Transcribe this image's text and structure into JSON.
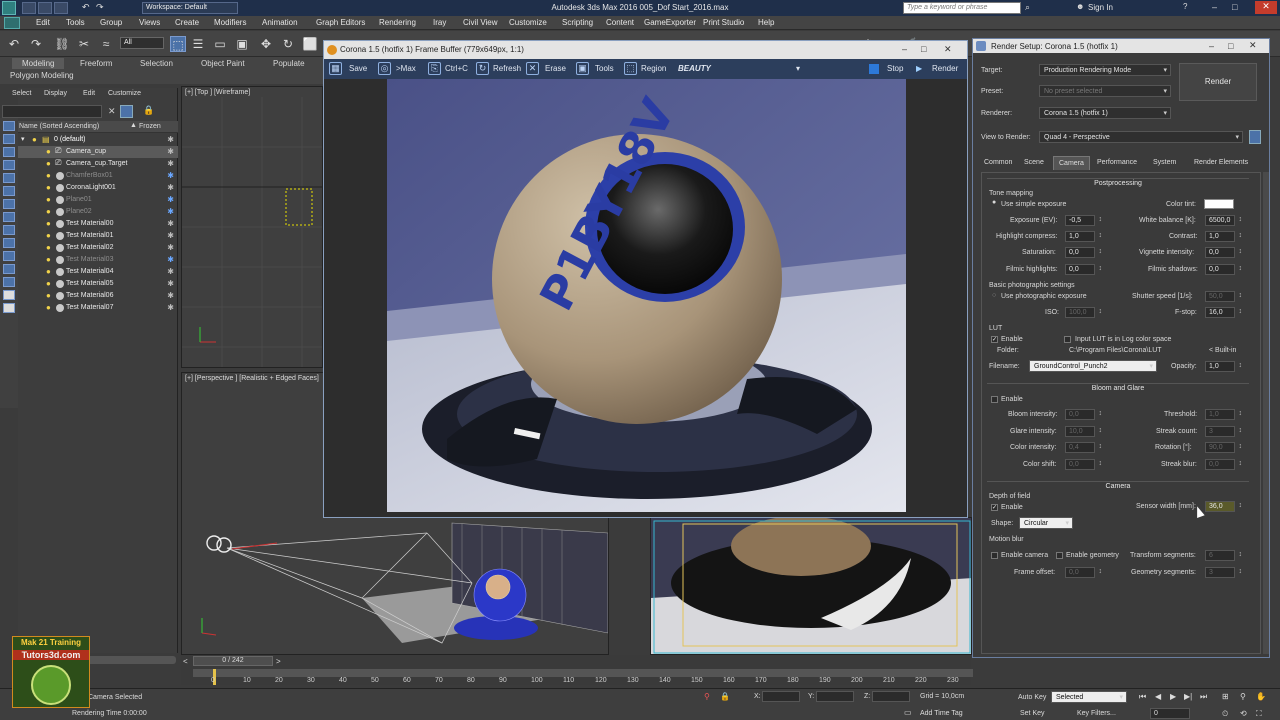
{
  "app": {
    "title": "Autodesk 3ds Max 2016    005_Dof Start_2016.max",
    "workspace": "Workspace: Default",
    "search_placeholder": "Type a keyword or phrase",
    "sign_in": "Sign In"
  },
  "menus": [
    "Edit",
    "Tools",
    "Group",
    "Views",
    "Create",
    "Modifiers",
    "Animation",
    "Graph Editors",
    "Rendering",
    "Iray",
    "Civil View",
    "Customize",
    "Scripting",
    "Content",
    "GameExporter",
    "Print Studio",
    "Help"
  ],
  "toolbar": {
    "selection_filter": "All"
  },
  "ribbon": {
    "tabs": [
      "Modeling",
      "Freeform",
      "Selection",
      "Object Paint",
      "Populate"
    ],
    "sub": "Polygon Modeling"
  },
  "explorer": {
    "menus": [
      "Select",
      "Display",
      "Edit",
      "Customize"
    ],
    "col_name": "Name (Sorted Ascending)",
    "col_frozen": "Frozen",
    "items": [
      {
        "name": "0 (default)",
        "type": "layer",
        "selected": false,
        "dim": false
      },
      {
        "name": "Camera_cup",
        "type": "camera",
        "selected": true,
        "dim": false
      },
      {
        "name": "Camera_cup.Target",
        "type": "camera",
        "selected": false,
        "dim": false
      },
      {
        "name": "ChamferBox01",
        "type": "object",
        "selected": false,
        "dim": true
      },
      {
        "name": "CoronaLight001",
        "type": "object",
        "selected": false,
        "dim": false
      },
      {
        "name": "Plane01",
        "type": "object",
        "selected": false,
        "dim": true
      },
      {
        "name": "Plane02",
        "type": "object",
        "selected": false,
        "dim": true
      },
      {
        "name": "Test Material00",
        "type": "object",
        "selected": false,
        "dim": false
      },
      {
        "name": "Test Material01",
        "type": "object",
        "selected": false,
        "dim": false
      },
      {
        "name": "Test Material02",
        "type": "object",
        "selected": false,
        "dim": false
      },
      {
        "name": "Test Material03",
        "type": "object",
        "selected": false,
        "dim": true
      },
      {
        "name": "Test Material04",
        "type": "object",
        "selected": false,
        "dim": false
      },
      {
        "name": "Test Material05",
        "type": "object",
        "selected": false,
        "dim": false
      },
      {
        "name": "Test Material06",
        "type": "object",
        "selected": false,
        "dim": false
      },
      {
        "name": "Test Material07",
        "type": "object",
        "selected": false,
        "dim": false
      }
    ]
  },
  "viewports": {
    "top": "[+] [Top ] [Wireframe]",
    "perspective": "[+] [Perspective ] [Realistic + Edged Faces]"
  },
  "framebuffer": {
    "title": "Corona 1.5 (hotfix 1) Frame Buffer (779x649px, 1:1)",
    "save": "Save",
    "max": ">Max",
    "ctrlc": "Ctrl+C",
    "refresh": "Refresh",
    "erase": "Erase",
    "tools": "Tools",
    "region": "Region",
    "channel": "BEAUTY",
    "stop": "Stop",
    "render": "Render",
    "sphere_text": "P1BY18V"
  },
  "render_setup": {
    "title": "Render Setup: Corona 1.5 (hotfix 1)",
    "target_label": "Target:",
    "target": "Production Rendering Mode",
    "preset_label": "Preset:",
    "preset": "No preset selected",
    "renderer_label": "Renderer:",
    "renderer": "Corona 1.5 (hotfix 1)",
    "view_label": "View to Render:",
    "view": "Quad 4 - Perspective",
    "render_btn": "Render",
    "tabs": [
      "Common",
      "Scene",
      "Camera",
      "Performance",
      "System",
      "Render Elements"
    ],
    "postprocessing": "Postprocessing",
    "tone_mapping": "Tone mapping",
    "use_simple_exposure": "Use simple exposure",
    "color_tint": "Color tint:",
    "exposure": {
      "label": "Exposure (EV):",
      "value": "-0,5"
    },
    "white_balance": {
      "label": "White balance [K]:",
      "value": "6500,0"
    },
    "highlight": {
      "label": "Highlight compress:",
      "value": "1,0"
    },
    "contrast": {
      "label": "Contrast:",
      "value": "1,0"
    },
    "saturation": {
      "label": "Saturation:",
      "value": "0,0"
    },
    "vignette": {
      "label": "Vignette intensity:",
      "value": "0,0"
    },
    "filmic_high": {
      "label": "Filmic highlights:",
      "value": "0,0"
    },
    "filmic_shad": {
      "label": "Filmic shadows:",
      "value": "0,0"
    },
    "basic_photo": "Basic photographic settings",
    "use_photo": "Use photographic exposure",
    "shutter": {
      "label": "Shutter speed [1/s]:",
      "value": "50,0"
    },
    "iso": {
      "label": "ISO:",
      "value": "100,0"
    },
    "fstop": {
      "label": "F-stop:",
      "value": "16,0"
    },
    "lut": "LUT",
    "lut_enable": "Enable",
    "lut_log": "Input LUT is in Log color space",
    "folder_label": "Folder:",
    "folder": "C:\\Program Files\\Corona\\LUT",
    "builtin": "< Built-in",
    "filename_label": "Filename:",
    "filename": "GroundControl_Punch2",
    "opacity": {
      "label": "Opacity:",
      "value": "1,0"
    },
    "bloom": "Bloom and Glare",
    "bloom_enable": "Enable",
    "bloom_int": {
      "label": "Bloom intensity:",
      "value": "0,0"
    },
    "threshold": {
      "label": "Threshold:",
      "value": "1,0"
    },
    "glare_int": {
      "label": "Glare intensity:",
      "value": "10,0"
    },
    "streak_count": {
      "label": "Streak count:",
      "value": "3"
    },
    "color_int": {
      "label": "Color intensity:",
      "value": "0,4"
    },
    "rotation": {
      "label": "Rotation [°]:",
      "value": "90,0"
    },
    "color_shift": {
      "label": "Color shift:",
      "value": "0,0"
    },
    "streak_blur": {
      "label": "Streak blur:",
      "value": "0,0"
    },
    "camera": "Camera",
    "dof": "Depth of field",
    "dof_enable": "Enable",
    "sensor": {
      "label": "Sensor width [mm]:",
      "value": "36,0"
    },
    "shape_label": "Shape:",
    "shape": "Circular",
    "motion_blur": "Motion blur",
    "enable_camera": "Enable camera",
    "enable_geometry": "Enable geometry",
    "transform_seg": {
      "label": "Transform segments:",
      "value": "6"
    },
    "frame_offset": {
      "label": "Frame offset:",
      "value": "0,0"
    },
    "geometry_seg": {
      "label": "Geometry segments:",
      "value": "3"
    }
  },
  "timeline": {
    "frame": "0 / 242",
    "ticks": [
      "0",
      "10",
      "20",
      "30",
      "40",
      "50",
      "60",
      "70",
      "80",
      "90",
      "100",
      "110",
      "120",
      "130",
      "140",
      "150",
      "160",
      "170",
      "180",
      "190",
      "200",
      "210",
      "220",
      "230",
      "240"
    ]
  },
  "status": {
    "selected": "Camera Selected",
    "render_time": "Rendering Time 0:00:00",
    "x_label": "X:",
    "y_label": "Y:",
    "z_label": "Z:",
    "grid": "Grid = 10,0cm",
    "add_time_tag": "Add Time Tag",
    "auto_key": "Auto Key",
    "auto_key_sel": "Selected",
    "set_key": "Set Key",
    "key_filters": "Key Filters...",
    "frame_field": "0"
  },
  "logo": {
    "line1": "Mak 21 Training",
    "line2": "Tutors3d.com"
  },
  "colors": {
    "accent": "#2c3e5c",
    "selection": "#4c72a8",
    "bulb": "#f0d24a"
  }
}
